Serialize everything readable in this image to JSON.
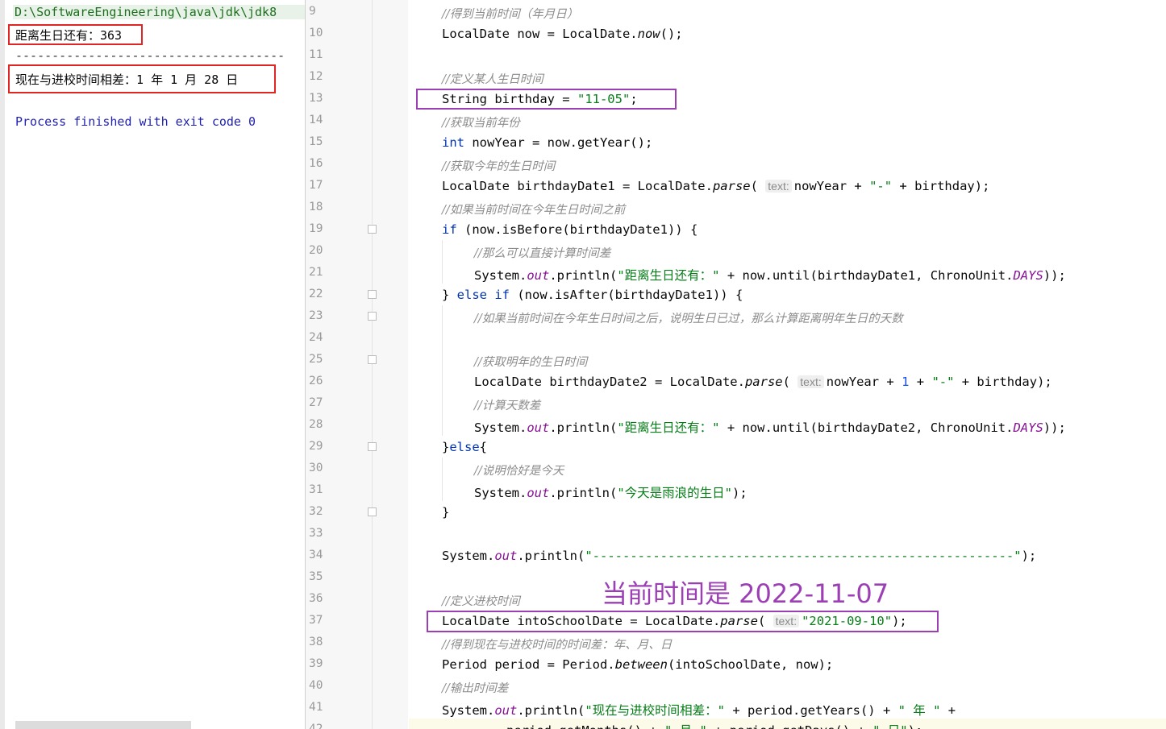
{
  "console": {
    "path": "D:\\SoftwareEngineering\\java\\jdk\\jdk8",
    "days_line": "距离生日还有：363",
    "separator": "-------------------------------------",
    "diff_line": "现在与进校时间相差：1 年 1 月 28 日",
    "process_line": "Process finished with exit code 0"
  },
  "annotation": "当前时间是 2022-11-07",
  "hint_label": "text:",
  "line_numbers": [
    "9",
    "10",
    "11",
    "12",
    "13",
    "14",
    "15",
    "16",
    "17",
    "18",
    "19",
    "20",
    "21",
    "22",
    "23",
    "24",
    "25",
    "26",
    "27",
    "28",
    "29",
    "30",
    "31",
    "32",
    "33",
    "34",
    "35",
    "36",
    "37",
    "38",
    "39",
    "40",
    "41",
    "42"
  ],
  "code": {
    "l9": "//得到当前时间（年月日）",
    "l10": "LocalDate now = LocalDate.now();",
    "l12": "//定义某人生日时间",
    "l13": "String birthday = \"11-05\";",
    "l14": "//获取当前年份",
    "l15": "int nowYear = now.getYear();",
    "l16": "//获取今年的生日时间",
    "l17": "LocalDate birthdayDate1 = LocalDate.parse( text: nowYear + \"-\" + birthday);",
    "l18": "//如果当前时间在今年生日时间之前",
    "l19": "if (now.isBefore(birthdayDate1)) {",
    "l20": "//那么可以直接计算时间差",
    "l21": "System.out.println(\"距离生日还有：\" + now.until(birthdayDate1, ChronoUnit.DAYS));",
    "l22": "} else if (now.isAfter(birthdayDate1)) {",
    "l23": "//如果当前时间在今年生日时间之后，说明生日已过，那么计算距离明年生日的天数",
    "l25": "//获取明年的生日时间",
    "l26": "LocalDate birthdayDate2 = LocalDate.parse( text: nowYear + 1 + \"-\" + birthday);",
    "l27": "//计算天数差",
    "l28": "System.out.println(\"距离生日还有：\" + now.until(birthdayDate2, ChronoUnit.DAYS));",
    "l29": "}else{",
    "l30": "//说明恰好是今天",
    "l31": "System.out.println(\"今天是雨浪的生日\");",
    "l32": "}",
    "l34": "System.out.println(\"--------------------------------------------------------\");",
    "l36": "//定义进校时间",
    "l37": "LocalDate intoSchoolDate = LocalDate.parse( text: \"2021-09-10\");",
    "l38": "//得到现在与进校时间的时间差：年、月、日",
    "l39": "Period period = Period.between(intoSchoolDate, now);",
    "l40": "//输出时间差",
    "l41": "System.out.println(\"现在与进校时间相差：\" + period.getYears() + \" 年 \" +",
    "l42": "period.getMonths() + \" 月 \" + period.getDays() + \" 日\");"
  },
  "colors": {
    "keyword": "#0033b3",
    "string": "#067d17",
    "comment": "#8c8c8c",
    "static_field": "#871094",
    "number": "#1750eb",
    "highlight_red": "#e02525",
    "highlight_purple": "#9c3fb4"
  }
}
